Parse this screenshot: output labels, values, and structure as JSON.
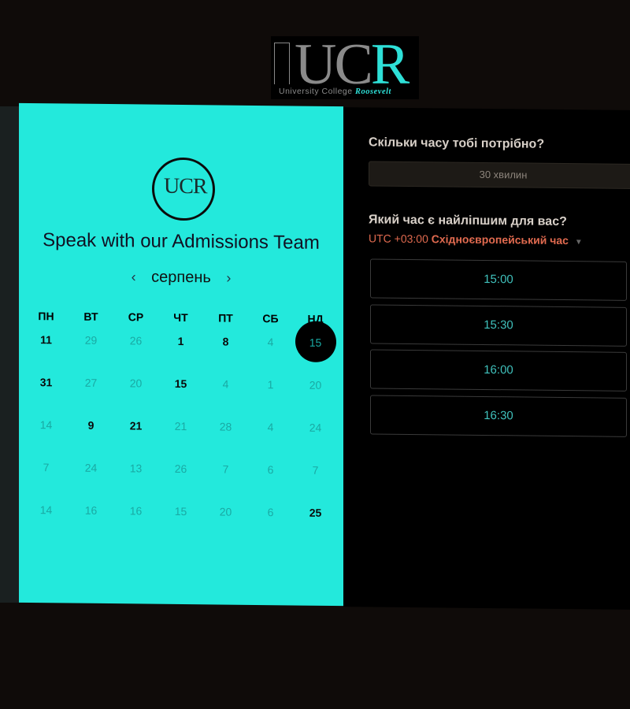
{
  "logo": {
    "main": "UC",
    "accent": "R",
    "subtitle": "University College",
    "subtitle_accent": "Roosevelt"
  },
  "left": {
    "badge": "UCR",
    "title": "Speak with our Admissions Team",
    "month": "серпень",
    "prev": "‹",
    "next": "›",
    "weekdays": [
      "ПН",
      "ВТ",
      "СР",
      "ЧТ",
      "ПТ",
      "СБ",
      "НД"
    ],
    "weeks": [
      [
        {
          "d": "11",
          "a": true
        },
        {
          "d": "29"
        },
        {
          "d": "26"
        },
        {
          "d": "1",
          "a": true
        },
        {
          "d": "8",
          "a": true
        },
        {
          "d": "4"
        },
        {
          "d": "15",
          "s": true
        }
      ],
      [
        {
          "d": "31",
          "a": true
        },
        {
          "d": "27"
        },
        {
          "d": "20"
        },
        {
          "d": "15",
          "a": true
        },
        {
          "d": "4"
        },
        {
          "d": "1"
        },
        {
          "d": "20"
        }
      ],
      [
        {
          "d": "14"
        },
        {
          "d": "9",
          "a": true
        },
        {
          "d": "21",
          "a": true
        },
        {
          "d": "21"
        },
        {
          "d": "28"
        },
        {
          "d": "4"
        },
        {
          "d": "24"
        }
      ],
      [
        {
          "d": "7"
        },
        {
          "d": "24"
        },
        {
          "d": "13"
        },
        {
          "d": "26"
        },
        {
          "d": "7"
        },
        {
          "d": "6"
        },
        {
          "d": "7"
        }
      ],
      [
        {
          "d": "14"
        },
        {
          "d": "16"
        },
        {
          "d": "16"
        },
        {
          "d": "15"
        },
        {
          "d": "20"
        },
        {
          "d": "6"
        },
        {
          "d": "25",
          "a": true
        }
      ]
    ]
  },
  "right": {
    "duration_q": "Скільки часу тобі потрібно?",
    "duration": "30 хвилин",
    "time_q": "Який час є найліпшим для вас?",
    "tz_offset": "UTC +03:00",
    "tz_name": "Східноєвропейський час",
    "caret": "▼",
    "slots": [
      "15:00",
      "15:30",
      "16:00",
      "16:30"
    ]
  }
}
